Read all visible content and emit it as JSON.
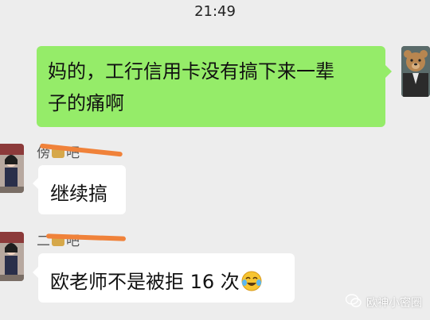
{
  "status": {
    "time": "21:49"
  },
  "chat": {
    "outgoing": {
      "line1": "妈的，工行信用卡没有搞下来一辈",
      "line2": "子的痛啊"
    },
    "incoming": [
      {
        "sender_visible": "傍",
        "sender_suffix": "吧",
        "text": "继续搞"
      },
      {
        "sender_visible": "二",
        "sender_suffix": "吧",
        "text": "欧老师不是被拒 16 次"
      }
    ]
  },
  "watermark": {
    "text": "欧神小密圈"
  },
  "colors": {
    "background": "#ededed",
    "outgoing_bubble": "#95ec69",
    "incoming_bubble": "#ffffff",
    "scribble": "#f0823a"
  },
  "icons": [
    "avatar-bear-icon",
    "avatar-girl-icon",
    "money-bag-icon",
    "laughing-tears-emoji-icon",
    "wechat-icon"
  ]
}
